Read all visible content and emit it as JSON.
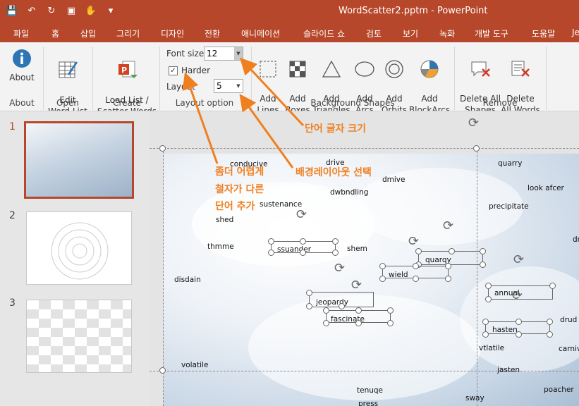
{
  "window": {
    "title": "WordScatter2.pptm  -  PowerPoint"
  },
  "qat": [
    "save-icon",
    "undo-icon",
    "redo-icon",
    "presenter-icon",
    "touch-icon",
    "customize-icon"
  ],
  "tabs": [
    "파일",
    "홈",
    "삽입",
    "그리기",
    "디자인",
    "전환",
    "애니메이션",
    "슬라이드 쇼",
    "검토",
    "보기",
    "녹화",
    "개발 도구",
    "도움말",
    "Je"
  ],
  "ribbon": {
    "about": {
      "button": "About",
      "group": "About"
    },
    "open": {
      "button": "Edit\nWord List",
      "group": "Open"
    },
    "create": {
      "button": "Load List /\nScatter Words",
      "group": "Create"
    },
    "layout": {
      "font_size_label": "Font size",
      "font_size_value": "12",
      "harder_label": "Harder",
      "harder_checked": true,
      "layout_label": "Layout",
      "layout_value": "5",
      "group": "Layout option"
    },
    "bg": {
      "buttons": [
        "Add\nLines",
        "Add\nBoxes",
        "Add\nTriangles",
        "Add\nArcs",
        "Add\nOrbits",
        "Add\nBlockArcs"
      ],
      "group": "Background Shapes"
    },
    "remove": {
      "buttons": [
        "Delete All\nShapes",
        "Delete\nAll Words"
      ],
      "group": "Remove"
    }
  },
  "slides": [
    "1",
    "2",
    "3"
  ],
  "words": [
    "conducive",
    "drive",
    "dmive",
    "quarry",
    "dwbndling",
    "look afcer",
    "sustenance",
    "precipitate",
    "shed",
    "ssuander",
    "shem",
    "thmme",
    "quarqy",
    "wield",
    "disdain",
    "annual",
    "jeopardy",
    "fascinate",
    "drud",
    "hasten",
    "vtlatile",
    "carniv",
    "jasten",
    "volatile",
    "tenuqe",
    "poacher",
    "sway",
    "press",
    "dr"
  ],
  "annotations": {
    "font_size": "단어 글자 크기",
    "layout": "배경레이아웃 선택",
    "harder": [
      "좀더 어렵게",
      "철자가 다른",
      "단어 추가"
    ]
  },
  "colors": {
    "accent": "#b7472a",
    "annotation": "#f07f1f"
  }
}
